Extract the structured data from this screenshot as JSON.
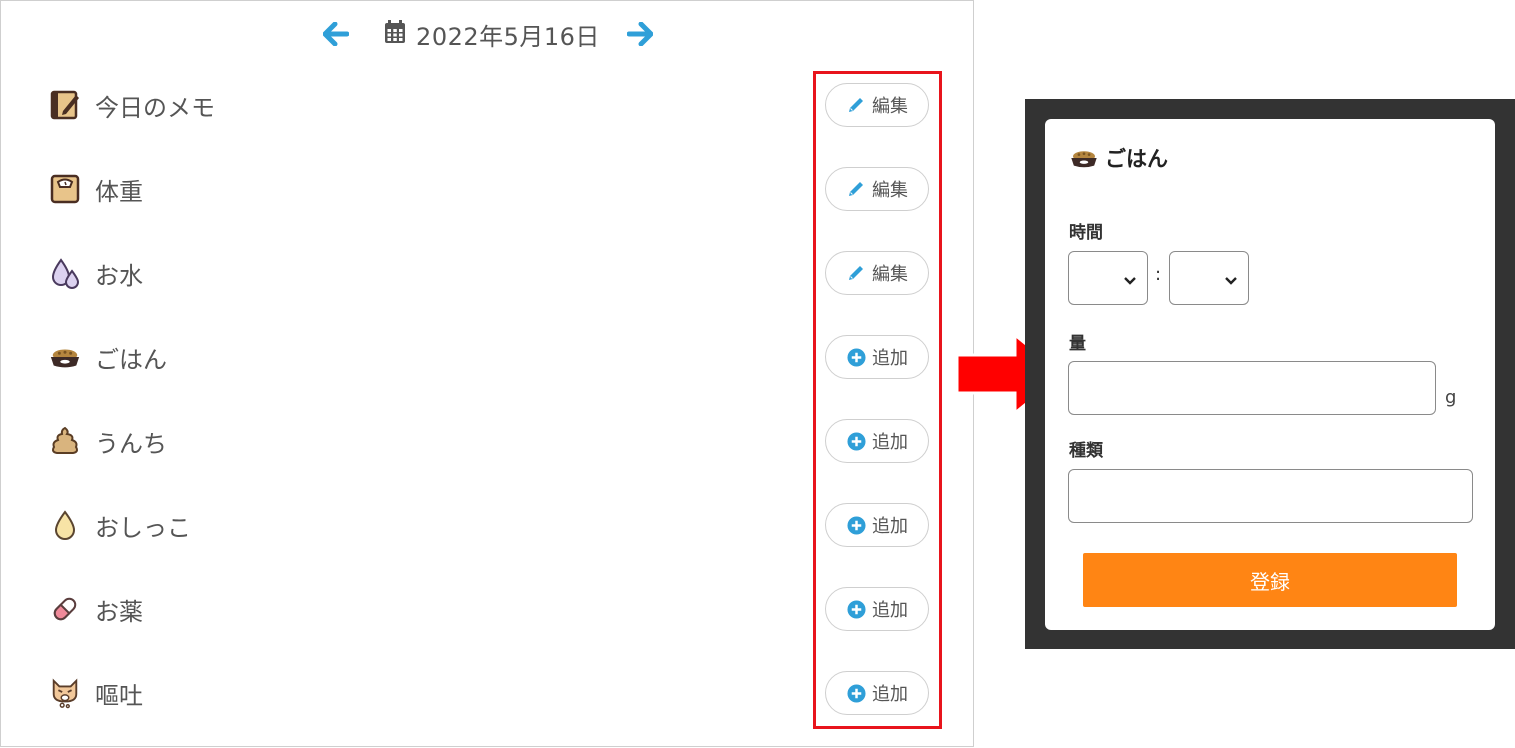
{
  "header": {
    "date": "2022年5月16日",
    "prev_icon": "arrow-left-icon",
    "next_icon": "arrow-right-icon",
    "calendar_icon": "calendar-icon"
  },
  "records": [
    {
      "label": "今日のメモ",
      "icon": "memo-icon",
      "action": "編集",
      "action_icon": "pencil-icon"
    },
    {
      "label": "体重",
      "icon": "scale-icon",
      "action": "編集",
      "action_icon": "pencil-icon"
    },
    {
      "label": "お水",
      "icon": "water-drops-icon",
      "action": "編集",
      "action_icon": "pencil-icon"
    },
    {
      "label": "ごはん",
      "icon": "food-bowl-icon",
      "action": "追加",
      "action_icon": "plus-circle-icon"
    },
    {
      "label": "うんち",
      "icon": "poop-icon",
      "action": "追加",
      "action_icon": "plus-circle-icon"
    },
    {
      "label": "おしっこ",
      "icon": "urine-drop-icon",
      "action": "追加",
      "action_icon": "plus-circle-icon"
    },
    {
      "label": "お薬",
      "icon": "pill-icon",
      "action": "追加",
      "action_icon": "plus-circle-icon"
    },
    {
      "label": "嘔吐",
      "icon": "vomit-cat-icon",
      "action": "追加",
      "action_icon": "plus-circle-icon"
    }
  ],
  "modal": {
    "title": "ごはん",
    "title_icon": "food-bowl-icon",
    "time_label": "時間",
    "time_separator": ":",
    "hour_value": "",
    "minute_value": "",
    "amount_label": "量",
    "amount_value": "",
    "amount_unit": "g",
    "kind_label": "種類",
    "kind_value": "",
    "submit_label": "登録"
  },
  "colors": {
    "accent_blue": "#2f9fd8",
    "highlight_red": "#e8141c",
    "submit_orange": "#ff8514",
    "modal_frame": "#333333"
  }
}
